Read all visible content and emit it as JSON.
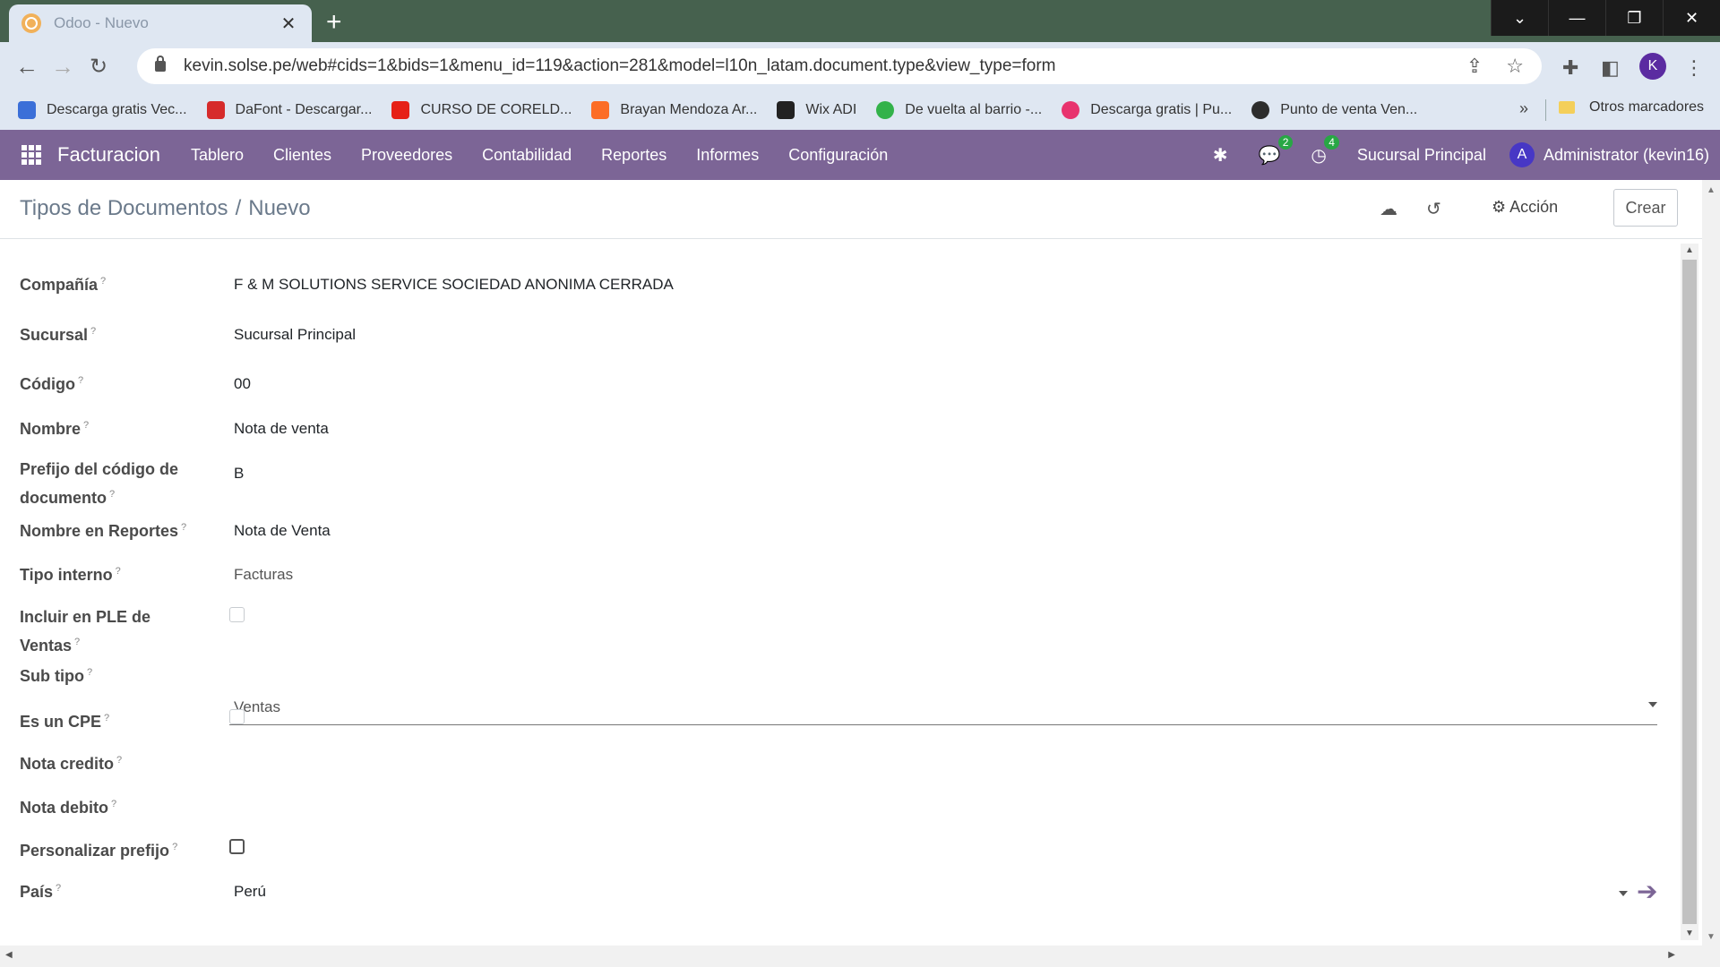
{
  "browser": {
    "tab_title": "Odoo - Nuevo",
    "url": "kevin.solse.pe/web#cids=1&bids=1&menu_id=119&action=281&model=l10n_latam.document.type&view_type=form",
    "profile_initial": "K",
    "bookmarks": [
      {
        "label": "Descarga gratis Vec...",
        "color": "#3b6fd8"
      },
      {
        "label": "DaFont - Descargar...",
        "color": "#d62b2b"
      },
      {
        "label": "CURSO DE CORELD...",
        "color": "#e62117"
      },
      {
        "label": "Brayan Mendoza Ar...",
        "color": "#fc6d26"
      },
      {
        "label": "Wix ADI",
        "color": "#222222"
      },
      {
        "label": "De vuelta al barrio -...",
        "color": "#33b24a"
      },
      {
        "label": "Descarga gratis | Pu...",
        "color": "#e8336e"
      },
      {
        "label": "Punto de venta Ven...",
        "color": "#2d2d2d"
      }
    ],
    "more_bookmarks": "»",
    "other_bookmarks": "Otros marcadores"
  },
  "navbar": {
    "app_name": "Facturacion",
    "menu": [
      "Tablero",
      "Clientes",
      "Proveedores",
      "Contabilidad",
      "Reportes",
      "Informes",
      "Configuración"
    ],
    "messages_count": "2",
    "activities_count": "4",
    "branch": "Sucursal Principal",
    "user_initial": "A",
    "user": "Administrator (kevin16)",
    "accent": "#7c6596"
  },
  "control_panel": {
    "breadcrumb_parent": "Tipos de Documentos",
    "breadcrumb_sep": "/",
    "breadcrumb_current": "Nuevo",
    "action_label": "Acción",
    "create_label": "Crear"
  },
  "form": {
    "compania_label": "Compañía",
    "compania_value": "F & M SOLUTIONS SERVICE SOCIEDAD ANONIMA CERRADA",
    "sucursal_label": "Sucursal",
    "sucursal_value": "Sucursal Principal",
    "codigo_label": "Código",
    "codigo_value": "00",
    "nombre_label": "Nombre",
    "nombre_value": "Nota de venta",
    "prefijo_label_1": "Prefijo del código de",
    "prefijo_label_2": "documento",
    "prefijo_value": "B",
    "nombre_reportes_label": "Nombre en Reportes",
    "nombre_reportes_value": "Nota de Venta",
    "tipo_interno_label": "Tipo interno",
    "tipo_interno_value": "Facturas",
    "incluir_ple_label_1": "Incluir en PLE de",
    "incluir_ple_label_2": "Ventas",
    "incluir_ple_checked": false,
    "sub_tipo_label": "Sub tipo",
    "sub_tipo_value": "Ventas",
    "es_cpe_label": "Es un CPE",
    "es_cpe_checked": false,
    "nota_credito_label": "Nota credito",
    "nota_debito_label": "Nota debito",
    "personalizar_label": "Personalizar prefijo",
    "personalizar_checked": false,
    "pais_label": "País",
    "pais_value": "Perú",
    "help_mark": "?"
  }
}
